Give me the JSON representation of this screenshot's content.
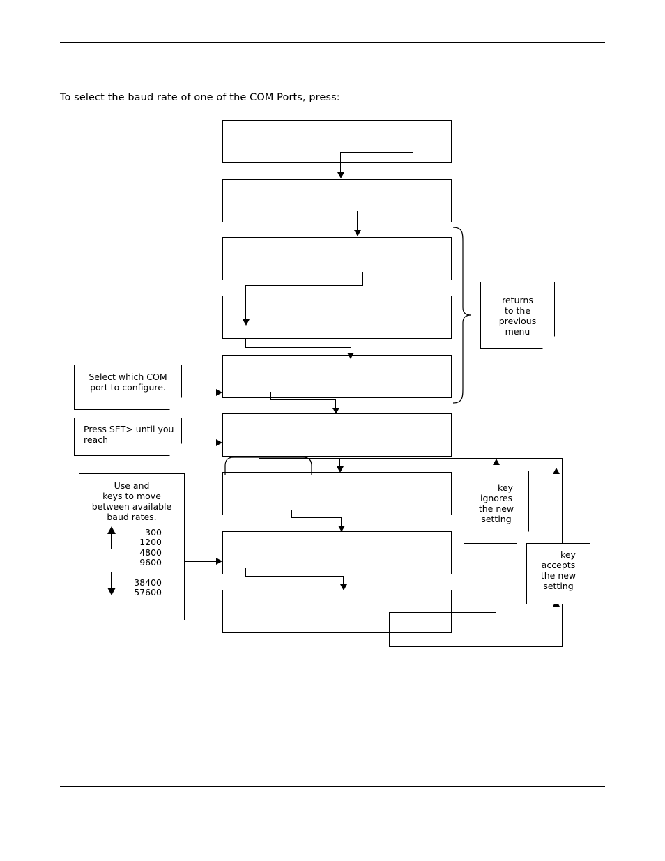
{
  "document": {
    "intro_text": "To select the baud rate of one of the COM Ports, press:"
  },
  "flow": {
    "boxes": [
      {
        "id": "box-1",
        "label": ""
      },
      {
        "id": "box-2",
        "label": ""
      },
      {
        "id": "box-3",
        "label": ""
      },
      {
        "id": "box-4",
        "label": ""
      },
      {
        "id": "box-5",
        "label": ""
      },
      {
        "id": "box-6",
        "label": ""
      },
      {
        "id": "box-7",
        "label": ""
      },
      {
        "id": "box-8",
        "label": ""
      },
      {
        "id": "box-9",
        "label": ""
      }
    ]
  },
  "notes": {
    "returns": {
      "line1": "returns",
      "line2": "to the",
      "line3": "previous",
      "line4": "menu"
    },
    "select_com": {
      "line1": "Select which COM",
      "line2": "port to configure."
    },
    "press_set": {
      "line1": "Press SET> until you",
      "line2": "  reach"
    },
    "ignores": {
      "line1": "key",
      "line2": "ignores",
      "line3": "the new",
      "line4": "setting"
    },
    "accepts": {
      "line1": "key",
      "line2": "accepts",
      "line3": "the new",
      "line4": "setting"
    },
    "baud": {
      "head_line1": "Use           and",
      "head_line2": "keys to move",
      "head_line3": "between available",
      "head_line4": "baud rates.",
      "rates_top": [
        "300",
        "1200",
        "4800",
        "9600"
      ],
      "rates_bottom": [
        "38400",
        "57600"
      ]
    }
  }
}
